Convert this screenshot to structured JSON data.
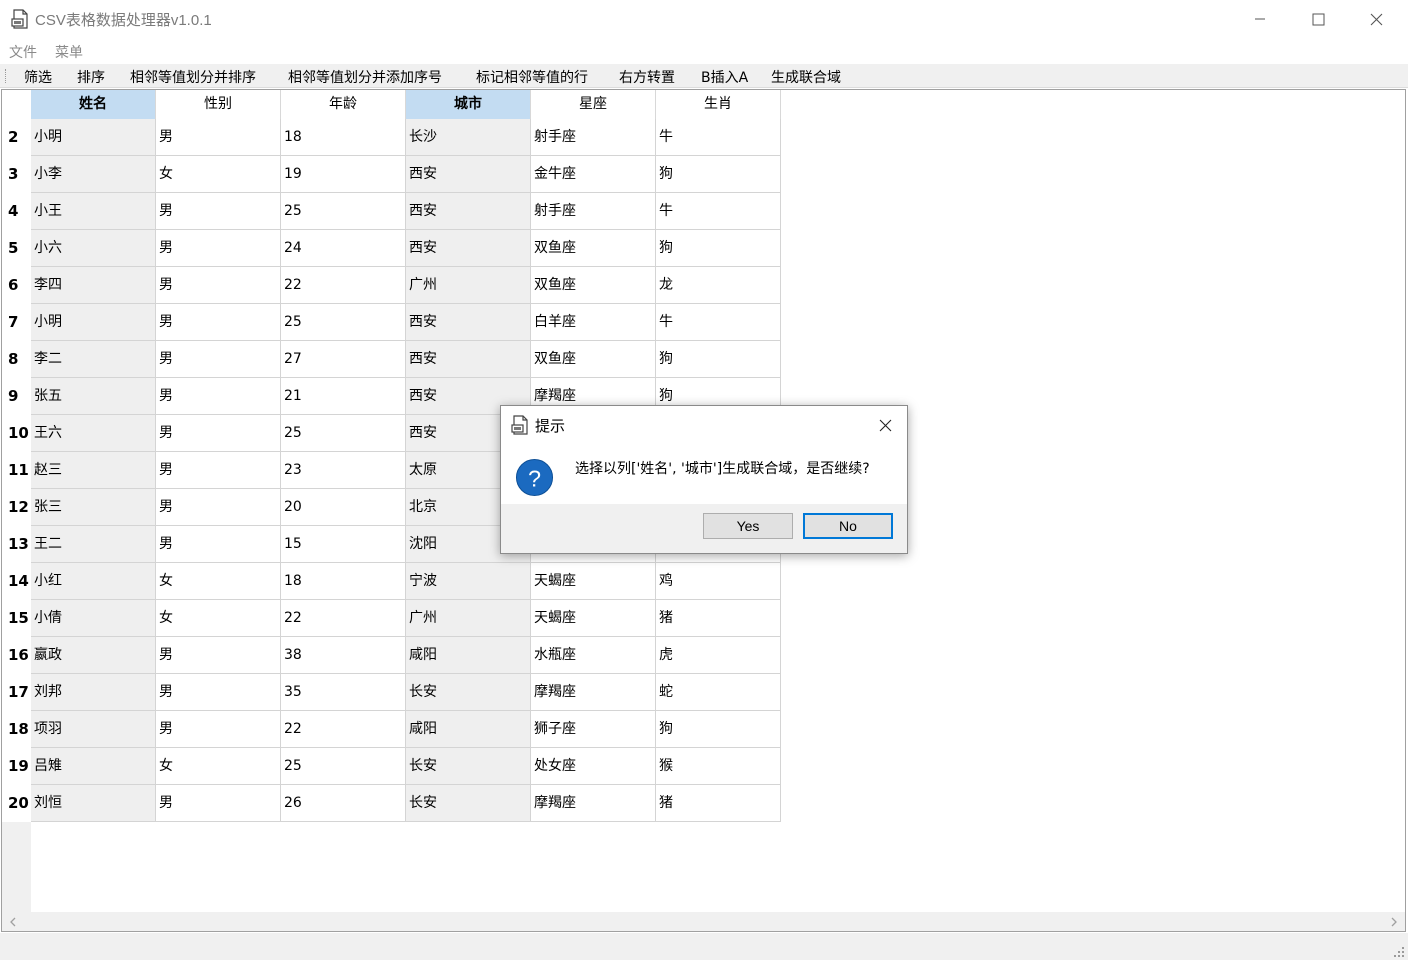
{
  "window": {
    "title": "CSV表格数据处理器v1.0.1",
    "controls": [
      "minimize-icon",
      "maximize-icon",
      "close-icon"
    ]
  },
  "menu": {
    "items": [
      "文件",
      "菜单"
    ]
  },
  "toolbar": {
    "items": [
      "筛选",
      "排序",
      "相邻等值划分并排序",
      "相邻等值划分并添加序号",
      "标记相邻等值的行",
      "右方转置",
      "B插入A",
      "生成联合域"
    ]
  },
  "table": {
    "columns": [
      {
        "label": "姓名",
        "selected": true
      },
      {
        "label": "性别",
        "selected": false
      },
      {
        "label": "年龄",
        "selected": false
      },
      {
        "label": "城市",
        "selected": true
      },
      {
        "label": "星座",
        "selected": false
      },
      {
        "label": "生肖",
        "selected": false
      }
    ],
    "rows": [
      {
        "index": "2",
        "cells": [
          "小明",
          "男",
          "18",
          "长沙",
          "射手座",
          "牛"
        ]
      },
      {
        "index": "3",
        "cells": [
          "小李",
          "女",
          "19",
          "西安",
          "金牛座",
          "狗"
        ]
      },
      {
        "index": "4",
        "cells": [
          "小王",
          "男",
          "25",
          "西安",
          "射手座",
          "牛"
        ]
      },
      {
        "index": "5",
        "cells": [
          "小六",
          "男",
          "24",
          "西安",
          "双鱼座",
          "狗"
        ]
      },
      {
        "index": "6",
        "cells": [
          "李四",
          "男",
          "22",
          "广州",
          "双鱼座",
          "龙"
        ]
      },
      {
        "index": "7",
        "cells": [
          "小明",
          "男",
          "25",
          "西安",
          "白羊座",
          "牛"
        ]
      },
      {
        "index": "8",
        "cells": [
          "李二",
          "男",
          "27",
          "西安",
          "双鱼座",
          "狗"
        ]
      },
      {
        "index": "9",
        "cells": [
          "张五",
          "男",
          "21",
          "西安",
          "摩羯座",
          "狗"
        ]
      },
      {
        "index": "10",
        "cells": [
          "王六",
          "男",
          "25",
          "西安",
          "",
          ""
        ]
      },
      {
        "index": "11",
        "cells": [
          "赵三",
          "男",
          "23",
          "太原",
          "",
          ""
        ]
      },
      {
        "index": "12",
        "cells": [
          "张三",
          "男",
          "20",
          "北京",
          "",
          ""
        ]
      },
      {
        "index": "13",
        "cells": [
          "王二",
          "男",
          "15",
          "沈阳",
          "",
          ""
        ]
      },
      {
        "index": "14",
        "cells": [
          "小红",
          "女",
          "18",
          "宁波",
          "天蝎座",
          "鸡"
        ]
      },
      {
        "index": "15",
        "cells": [
          "小倩",
          "女",
          "22",
          "广州",
          "天蝎座",
          "猪"
        ]
      },
      {
        "index": "16",
        "cells": [
          "嬴政",
          "男",
          "38",
          "咸阳",
          "水瓶座",
          "虎"
        ]
      },
      {
        "index": "17",
        "cells": [
          "刘邦",
          "男",
          "35",
          "长安",
          "摩羯座",
          "蛇"
        ]
      },
      {
        "index": "18",
        "cells": [
          "项羽",
          "男",
          "22",
          "咸阳",
          "狮子座",
          "狗"
        ]
      },
      {
        "index": "19",
        "cells": [
          "吕雉",
          "女",
          "25",
          "长安",
          "处女座",
          "猴"
        ]
      },
      {
        "index": "20",
        "cells": [
          "刘恒",
          "男",
          "26",
          "长安",
          "摩羯座",
          "猪"
        ]
      }
    ]
  },
  "dialog": {
    "title": "提示",
    "message": "选择以列['姓名', '城市']生成联合域，是否继续?",
    "icon": "question-icon",
    "yes_label": "Yes",
    "no_label": "No"
  },
  "colors": {
    "selected_header": "#c3dcf2",
    "selected_cell": "#efefef",
    "focus_border": "#0078d7",
    "question_icon": "#1b6ac0"
  }
}
